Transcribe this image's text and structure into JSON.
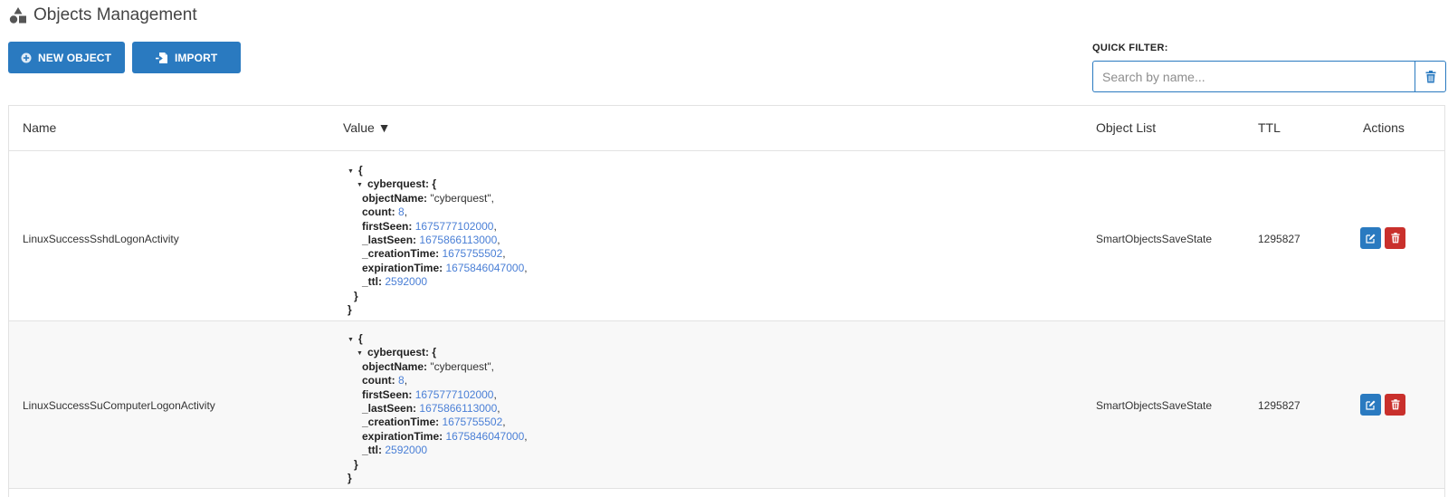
{
  "header": {
    "title": "Objects Management",
    "icon": "shapes-icon"
  },
  "toolbar": {
    "new_object_label": "NEW OBJECT",
    "new_object_icon": "plus-circle-icon",
    "import_label": "IMPORT",
    "import_icon": "file-import-icon"
  },
  "quick_filter": {
    "label": "QUICK FILTER:",
    "placeholder": "Search by name...",
    "value": "",
    "clear_icon": "trash-icon"
  },
  "table": {
    "columns": {
      "name": "Name",
      "value": "Value ▼",
      "object_list": "Object List",
      "ttl": "TTL",
      "actions": "Actions"
    },
    "rows": [
      {
        "name": "LinuxSuccessSshdLogonActivity",
        "value": {
          "open_brace": "{",
          "root_key": "cyberquest",
          "fields": [
            {
              "key": "objectName",
              "value": "\"cyberquest\""
            },
            {
              "key": "count",
              "value": "8"
            },
            {
              "key": "firstSeen",
              "value": "1675777102000"
            },
            {
              "key": "_lastSeen",
              "value": "1675866113000"
            },
            {
              "key": "_creationTime",
              "value": "1675755502"
            },
            {
              "key": "expirationTime",
              "value": "1675846047000"
            },
            {
              "key": "_ttl",
              "value": "2592000"
            }
          ],
          "close_brace": "}"
        },
        "object_list": "SmartObjectsSaveState",
        "ttl": "1295827"
      },
      {
        "name": "LinuxSuccessSuComputerLogonActivity",
        "value": {
          "open_brace": "{",
          "root_key": "cyberquest",
          "fields": [
            {
              "key": "objectName",
              "value": "\"cyberquest\""
            },
            {
              "key": "count",
              "value": "8"
            },
            {
              "key": "firstSeen",
              "value": "1675777102000"
            },
            {
              "key": "_lastSeen",
              "value": "1675866113000"
            },
            {
              "key": "_creationTime",
              "value": "1675755502"
            },
            {
              "key": "expirationTime",
              "value": "1675846047000"
            },
            {
              "key": "_ttl",
              "value": "2592000"
            }
          ],
          "close_brace": "}"
        },
        "object_list": "SmartObjectsSaveState",
        "ttl": "1295827"
      }
    ],
    "action_icons": {
      "edit": "edit-icon",
      "delete": "trash-icon"
    }
  },
  "colors": {
    "primary": "#2a7ac0",
    "danger": "#c9302c",
    "json_number": "#4a7fd6",
    "row_alt": "#f8f8f8"
  }
}
